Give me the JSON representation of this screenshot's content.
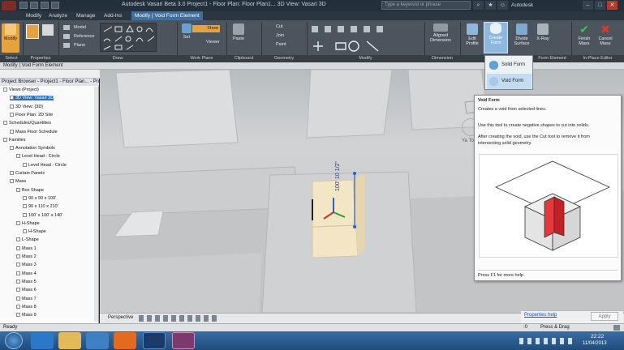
{
  "window": {
    "title": "Autodesk Vasari Beta 3.0    Project1 - Floor Plan: Floor Plan1... 3D View: Vasari 3D",
    "search_placeholder": "Type a keyword or phrase",
    "account": "Autodesk"
  },
  "tabs": [
    "Modify",
    "Analyze",
    "Manage",
    "Add-Ins",
    "Modify | Void Form Element"
  ],
  "ribbon": {
    "modify": "Modify",
    "model": "Model",
    "reference": "Reference",
    "plane": "Plane",
    "show": "Show",
    "set": "Set",
    "viewer": "Viewer",
    "paste": "Paste",
    "cut": "Cut",
    "join": "Join",
    "paint": "Paint",
    "aligned_dimension": "Aligned Dimension",
    "edit_profile": "Edit Profile",
    "create_form": "Create Form",
    "divide_surface": "Divide Surface",
    "xray": "X-Ray",
    "finish_mass": "Finish Mass",
    "cancel_mass": "Cancel Mass"
  },
  "panels": [
    "Select",
    "Properties",
    "Draw",
    "Work Plane",
    "Clipboard",
    "Geometry",
    "Modify",
    "Dimension",
    "Form Element",
    "In-Place Editor"
  ],
  "context_label": "Modify | Void Form Element",
  "dropdown": [
    "Solid Form",
    "Void Form"
  ],
  "browser": {
    "header": "Project Browser - Project1 - Floor Plan... - Proje...",
    "items": [
      {
        "label": "Views (Project)",
        "indent": 0
      },
      {
        "label": "3D View: Vasari 3D",
        "indent": 1,
        "selected": true
      },
      {
        "label": "3D View: {3D}",
        "indent": 1
      },
      {
        "label": "Floor Plan: 2D Site",
        "indent": 1
      },
      {
        "label": "Schedules/Quantities",
        "indent": 0
      },
      {
        "label": "Mass Floor Schedule",
        "indent": 1
      },
      {
        "label": "Families",
        "indent": 0
      },
      {
        "label": "Annotation Symbols",
        "indent": 1
      },
      {
        "label": "Level Head - Circle",
        "indent": 2
      },
      {
        "label": "Level Head - Circle",
        "indent": 3
      },
      {
        "label": "Curtain Panels",
        "indent": 1
      },
      {
        "label": "Mass",
        "indent": 1
      },
      {
        "label": "Box Shape",
        "indent": 2
      },
      {
        "label": "90 x 90 x 100'",
        "indent": 3
      },
      {
        "label": "90 x 110 x 210'",
        "indent": 3
      },
      {
        "label": "100' x 100' x 140'",
        "indent": 3
      },
      {
        "label": "H-Shape",
        "indent": 2
      },
      {
        "label": "H-Shape",
        "indent": 3
      },
      {
        "label": "L-Shape",
        "indent": 2
      },
      {
        "label": "Mass 1",
        "indent": 2
      },
      {
        "label": "Mass 2",
        "indent": 2
      },
      {
        "label": "Mass 3",
        "indent": 2
      },
      {
        "label": "Mass 4",
        "indent": 2
      },
      {
        "label": "Mass 5",
        "indent": 2
      },
      {
        "label": "Mass 6",
        "indent": 2
      },
      {
        "label": "Mass 7",
        "indent": 2
      },
      {
        "label": "Mass 8",
        "indent": 2
      },
      {
        "label": "Mass 9",
        "indent": 2
      }
    ]
  },
  "tooltip": {
    "title": "Void Form",
    "line1": "Creates a void from selected lines.",
    "line2": "Use this tool to create negative shapes to cut into solids.",
    "line3": "After creating the void, use the Cut tool to remove it from",
    "line4": "intersecting solid geometry.",
    "footer": "Press F1 for more help"
  },
  "viewport": {
    "dimension": "100' 10 1/2\"",
    "view_scale": "Perspective",
    "viewcube_label": "Ya To"
  },
  "properties": {
    "help": "Properties help",
    "apply": "Apply"
  },
  "status": {
    "left": "Ready",
    "right": "Press & Drag",
    "zero": ":0"
  },
  "taskbar": {
    "time": "22:22",
    "date": "11/04/2013"
  }
}
